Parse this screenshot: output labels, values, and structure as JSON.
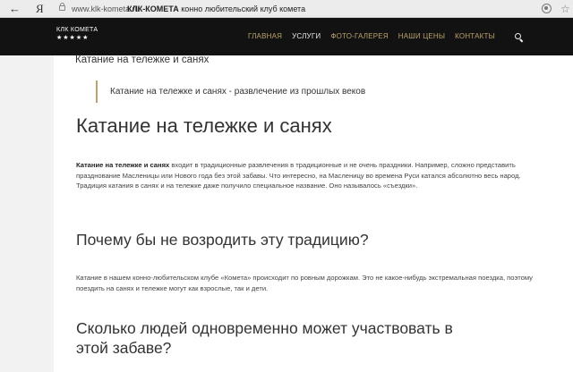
{
  "browser": {
    "back_glyph": "←",
    "yandex_glyph": "Я",
    "url_host": "www.klk-kometa.ru",
    "page_title_bold": "КЛК-КОМЕТА",
    "page_title_rest": " конно любительский клуб комета",
    "bookmark_glyph": "☆"
  },
  "header": {
    "logo_text": "КЛК КОМЕТА",
    "logo_stars": "★★★★★",
    "nav": [
      {
        "label": "ГЛАВНАЯ"
      },
      {
        "label": "УСЛУГИ"
      },
      {
        "label": "ФОТО-ГАЛЕРЕЯ"
      },
      {
        "label": "НАШИ ЦЕНЫ"
      },
      {
        "label": "КОНТАКТЫ"
      }
    ],
    "active_index": 1,
    "accent_color": "#b9a36a",
    "search_icon": "search-icon"
  },
  "content": {
    "crumb_title": "Катание на тележке и санях",
    "quote": "Катание на тележке и санях - развлечение из прошлых веков",
    "h1": "Катание на тележке и санях",
    "p1_bold": "Катание на тележке и санях",
    "p1_rest": " входит в традиционные развлечения в традиционные и не очень праздники. Например, сложно представить празднование Масленицы или Нового года без этой забавы. Что интересно, на Масленицу во времена Руси катался абсолютно весь народ. Традиция катания в санях и на тележке даже получило специальное название. Оно называлось «съездки».",
    "h2_first": "Почему бы не возродить эту традицию?",
    "p2": "Катание в нашем конно-любительском клубе «Комета» происходит по ровным дорожкам. Это не какое-нибудь экстремальная поездка, поэтому поездить на санях и тележке могут как взрослые, так и дети.",
    "h2_second": "Сколько людей одновременно может участвовать в этой забаве?"
  }
}
